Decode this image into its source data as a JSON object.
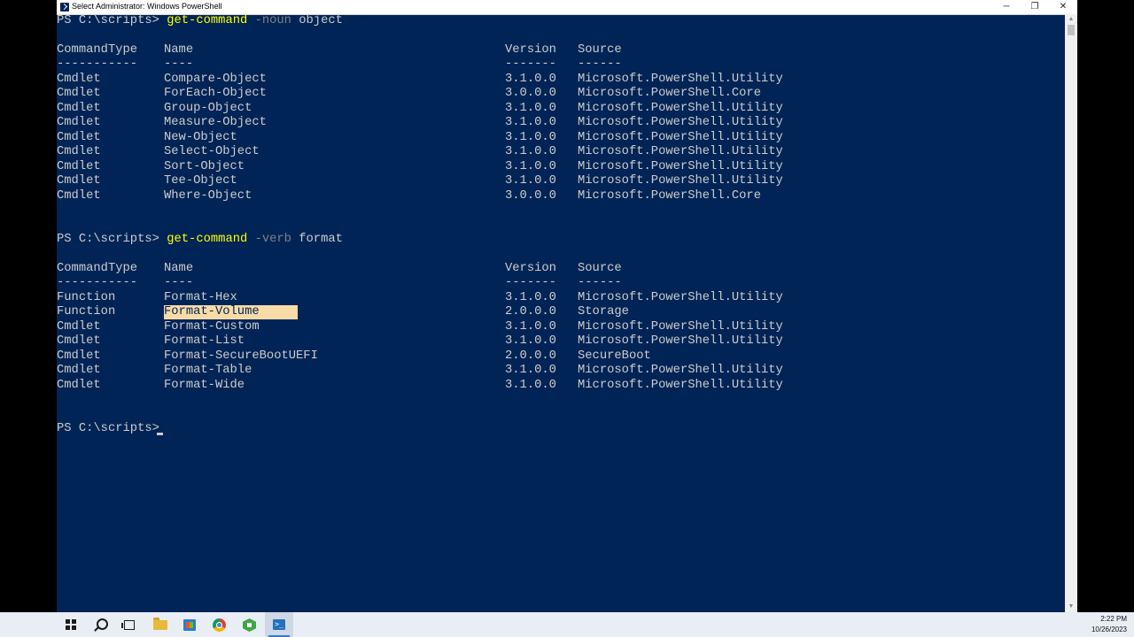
{
  "window": {
    "title": "Select Administrator: Windows PowerShell",
    "controls": {
      "minimize": "─",
      "maximize": "❐",
      "close": "✕"
    }
  },
  "session1": {
    "prompt": "PS C:\\scripts> ",
    "command": "get-command",
    "param": "-noun",
    "arg": "object",
    "headers": [
      "CommandType",
      "Name",
      "Version",
      "Source"
    ],
    "dashes": [
      "-----------",
      "----",
      "-------",
      "------"
    ],
    "rows": [
      [
        "Cmdlet",
        "Compare-Object",
        "3.1.0.0",
        "Microsoft.PowerShell.Utility"
      ],
      [
        "Cmdlet",
        "ForEach-Object",
        "3.0.0.0",
        "Microsoft.PowerShell.Core"
      ],
      [
        "Cmdlet",
        "Group-Object",
        "3.1.0.0",
        "Microsoft.PowerShell.Utility"
      ],
      [
        "Cmdlet",
        "Measure-Object",
        "3.1.0.0",
        "Microsoft.PowerShell.Utility"
      ],
      [
        "Cmdlet",
        "New-Object",
        "3.1.0.0",
        "Microsoft.PowerShell.Utility"
      ],
      [
        "Cmdlet",
        "Select-Object",
        "3.1.0.0",
        "Microsoft.PowerShell.Utility"
      ],
      [
        "Cmdlet",
        "Sort-Object",
        "3.1.0.0",
        "Microsoft.PowerShell.Utility"
      ],
      [
        "Cmdlet",
        "Tee-Object",
        "3.1.0.0",
        "Microsoft.PowerShell.Utility"
      ],
      [
        "Cmdlet",
        "Where-Object",
        "3.0.0.0",
        "Microsoft.PowerShell.Core"
      ]
    ]
  },
  "session2": {
    "prompt": "PS C:\\scripts> ",
    "command": "get-command",
    "param": "-verb",
    "arg": "format",
    "headers": [
      "CommandType",
      "Name",
      "Version",
      "Source"
    ],
    "dashes": [
      "-----------",
      "----",
      "-------",
      "------"
    ],
    "rows": [
      [
        "Function",
        "Format-Hex",
        "3.1.0.0",
        "Microsoft.PowerShell.Utility"
      ],
      [
        "Function",
        "Format-Volume",
        "2.0.0.0",
        "Storage"
      ],
      [
        "Cmdlet",
        "Format-Custom",
        "3.1.0.0",
        "Microsoft.PowerShell.Utility"
      ],
      [
        "Cmdlet",
        "Format-List",
        "3.1.0.0",
        "Microsoft.PowerShell.Utility"
      ],
      [
        "Cmdlet",
        "Format-SecureBootUEFI",
        "2.0.0.0",
        "SecureBoot"
      ],
      [
        "Cmdlet",
        "Format-Table",
        "3.1.0.0",
        "Microsoft.PowerShell.Utility"
      ],
      [
        "Cmdlet",
        "Format-Wide",
        "3.1.0.0",
        "Microsoft.PowerShell.Utility"
      ]
    ],
    "selected_text": "Format-Volume"
  },
  "current_prompt": "PS C:\\scripts> ",
  "colors": {
    "console_bg": "#012456",
    "console_fg": "#cccccc",
    "command": "#ffff00",
    "parameter": "#808080",
    "selection": "#f7dca8"
  },
  "taskbar": {
    "icons": [
      "windows-start-icon",
      "search-icon",
      "task-view-icon",
      "file-explorer-icon",
      "store-icon",
      "chrome-icon",
      "app-hex-icon",
      "powershell-icon"
    ],
    "time": "2:22 PM",
    "date": "10/26/2023"
  }
}
